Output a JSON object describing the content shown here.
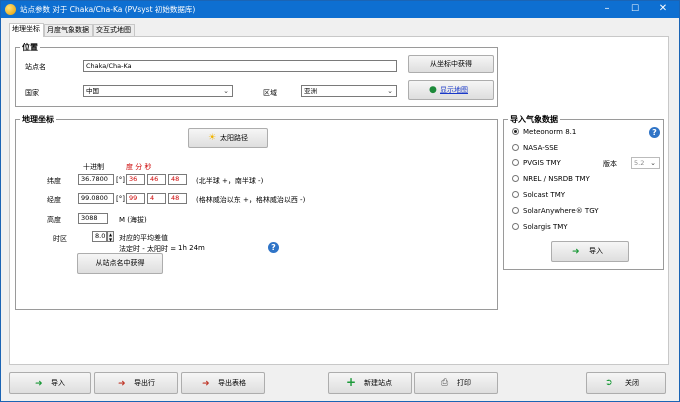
{
  "window": {
    "title": "站点参数 对于 Chaka/Cha-Ka (PVsyst 初始数据库)"
  },
  "tabs": [
    {
      "label": "地理坐标"
    },
    {
      "label": "月度气象数据"
    },
    {
      "label": "交互式地图"
    }
  ],
  "location": {
    "group_title": "位置",
    "site_name_label": "站点名",
    "site_name_value": "Chaka/Cha-Ka",
    "country_label": "国家",
    "country_value": "中国",
    "region_label": "区域",
    "region_value": "亚洲",
    "get_from_coords_button": "从坐标中获得",
    "show_map_button": "显示地图"
  },
  "geo": {
    "group_title": "地理坐标",
    "sun_path_button": "太阳路径",
    "decimal_header": "十进制",
    "dms_header": "度 分 秒",
    "latitude_label": "纬度",
    "latitude_decimal": "36.7800",
    "latitude_unit": "[°]",
    "latitude_deg": "36",
    "latitude_min": "46",
    "latitude_sec": "48",
    "latitude_hint": "(北半球 +，南半球 -)",
    "longitude_label": "经度",
    "longitude_decimal": "99.0800",
    "longitude_unit": "[°]",
    "longitude_deg": "99",
    "longitude_min": "4",
    "longitude_sec": "48",
    "longitude_hint": "(格林威治以东 +，格林威治以西 -)",
    "altitude_label": "高度",
    "altitude_value": "3088",
    "altitude_unit": "M (海拔)",
    "timezone_label": "时区",
    "timezone_value": "8.0",
    "timezone_note": "对应的平均差值",
    "timezone_diff_label": "法定时 - 太阳时 =",
    "timezone_diff_value": "1h 24m",
    "get_from_name_button": "从站点名中获得"
  },
  "import": {
    "group_title": "导入气象数据",
    "sources": [
      {
        "label": "Meteonorm 8.1",
        "selected": true
      },
      {
        "label": "NASA-SSE",
        "selected": false
      },
      {
        "label": "PVGIS TMY",
        "selected": false
      },
      {
        "label": "NREL / NSRDB TMY",
        "selected": false
      },
      {
        "label": "Solcast TMY",
        "selected": false
      },
      {
        "label": "SolarAnywhere® TGY",
        "selected": false
      },
      {
        "label": "Solargis TMY",
        "selected": false
      }
    ],
    "version_label": "版本",
    "version_value": "5.2",
    "import_button": "导入"
  },
  "bottom": {
    "import": "导入",
    "export_row": "导出行",
    "export_table": "导出表格",
    "new_site": "新建站点",
    "print": "打印",
    "close": "关闭"
  },
  "colors": {
    "title_bar": "#0e6fd1",
    "accent_red": "#cc0000",
    "help_blue": "#2f74c7"
  }
}
